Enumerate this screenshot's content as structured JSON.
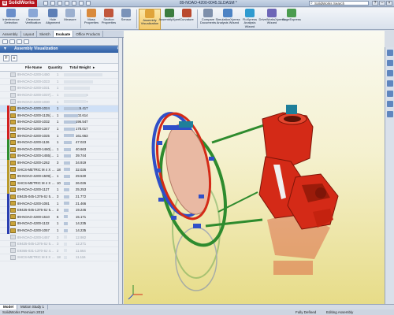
{
  "app": {
    "name": "SolidWorks",
    "document_title": "89-NOAO-4200-0045.SLDASM *",
    "search_placeholder": "SolidWorks Search"
  },
  "ribbon": [
    {
      "label": "Interference Detection",
      "color": "#6a8ec9"
    },
    {
      "label": "Clearance Verification",
      "color": "#8aa7d6"
    },
    {
      "label": "Hole Alignment",
      "color": "#5d7fb6"
    },
    {
      "label": "Measure",
      "color": "#9cb0cf"
    },
    {
      "label": "Mass Properties",
      "color": "#d98a3c"
    },
    {
      "label": "Section Properties",
      "color": "#c0563b"
    },
    {
      "label": "Sensor",
      "color": "#7b93b8"
    },
    {
      "label": "Assembly Visualization",
      "color": "#e0a43a",
      "active": true
    },
    {
      "label": "AssemblyXpert",
      "color": "#3c7c3f"
    },
    {
      "label": "Curvature",
      "color": "#b9492e"
    },
    {
      "label": "Compare Documents",
      "color": "#7d8faa"
    },
    {
      "label": "SimulationXpress Analysis Wizard",
      "color": "#4c83c4"
    },
    {
      "label": "FloXpress Analysis Wizard",
      "color": "#2f9bd0"
    },
    {
      "label": "DriveWorksXpress Wizard",
      "color": "#6d66b7"
    },
    {
      "label": "SageExpress",
      "color": "#4a9c4f"
    }
  ],
  "command_tabs": [
    {
      "label": "Assembly"
    },
    {
      "label": "Layout"
    },
    {
      "label": "Sketch"
    },
    {
      "label": "Evaluate",
      "active": true
    },
    {
      "label": "Office Products"
    }
  ],
  "panel": {
    "title": "Assembly Visualization",
    "columns": {
      "name": "File Name",
      "qty": "Quantity",
      "weight": "Total Weight"
    },
    "rows": [
      {
        "name": "89-NOAO-4200-1450",
        "qty": "1",
        "weight": "2142.565",
        "faded": true,
        "bar": 0.82
      },
      {
        "name": "89-NOAO-4200-1023",
        "qty": "1",
        "weight": "1146.889",
        "faded": true,
        "bar": 0.62
      },
      {
        "name": "89-NOAO-4200-1031",
        "qty": "1",
        "weight": "943.686",
        "faded": true,
        "bar": 0.55
      },
      {
        "name": "89-NOAO-4200-1037(Defa...",
        "qty": "1",
        "weight": "783.745",
        "faded": true,
        "bar": 0.48
      },
      {
        "name": "89-NOAO-4200-1030",
        "qty": "1",
        "weight": "756.867",
        "faded": true,
        "bar": 0.46
      },
      {
        "name": "89-NOAO-4200-1024",
        "qty": "1",
        "weight": "405.417",
        "hl": true,
        "bar": 0.34
      },
      {
        "name": "89-NOAO-4200-1125(Defa...",
        "qty": "1",
        "weight": "302.614",
        "bar": 0.3
      },
      {
        "name": "89-NOAO-4200-1032",
        "qty": "1",
        "weight": "196.547",
        "bar": 0.26
      },
      {
        "name": "89-NOAO-4200-1347",
        "qty": "1",
        "weight": "178.017",
        "bar": 0.24
      },
      {
        "name": "89-NOAO-4200-1025",
        "qty": "1",
        "weight": "161.663",
        "bar": 0.22
      },
      {
        "name": "89-NOAO-4200-1126",
        "qty": "1",
        "weight": "47.023",
        "bar": 0.16
      },
      {
        "name": "89-NOAO-4200-1460(Defa...",
        "qty": "1",
        "weight": "40.663",
        "bar": 0.15
      },
      {
        "name": "89-NOAO-4200-1455(Defa...",
        "qty": "1",
        "weight": "39.744",
        "bar": 0.15
      },
      {
        "name": "89-NOAO-4200-1262",
        "qty": "3",
        "weight": "34.919",
        "bar": 0.14
      },
      {
        "name": "SHCS-METRIC M 4 X 16...",
        "qty": "18",
        "weight": "32.026",
        "bar": 0.14
      },
      {
        "name": "89-NOAO-4200-1509(Defa...",
        "qty": "1",
        "weight": "29.530",
        "bar": 0.13
      },
      {
        "name": "SHCS-METRIC M 4 X 16...",
        "qty": "10",
        "weight": "26.026",
        "bar": 0.13
      },
      {
        "name": "89-NOAO-4200-1127",
        "qty": "1",
        "weight": "25.253",
        "bar": 0.12
      },
      {
        "name": "E9425-045-1376-SJ 50 LB...",
        "qty": "3",
        "weight": "21.772",
        "bar": 0.11
      },
      {
        "name": "89-NOAO-4200-1081",
        "qty": "1",
        "weight": "21.466",
        "bar": 0.11
      },
      {
        "name": "E9425-045-1376-SJ 50 LB...",
        "qty": "3",
        "weight": "19.246",
        "bar": 0.1
      },
      {
        "name": "89-NOAO-4200-1610",
        "qty": "6",
        "weight": "15.171",
        "bar": 0.09
      },
      {
        "name": "89-NOAO-4200-1122",
        "qty": "1",
        "weight": "14.235",
        "bar": 0.08
      },
      {
        "name": "89-NOAO-4200-1057",
        "qty": "1",
        "weight": "14.235",
        "bar": 0.08
      },
      {
        "name": "89-NOAO-4200-1457",
        "qty": "3",
        "weight": "12.982",
        "faded": true,
        "bar": 0.07
      },
      {
        "name": "E9425-045-1376-SJ 50 LB...",
        "qty": "3",
        "weight": "12.271",
        "faded": true,
        "bar": 0.07
      },
      {
        "name": "E9365-031-1370-SJ 44 LB...",
        "qty": "2",
        "weight": "11.664",
        "faded": true,
        "bar": 0.06
      },
      {
        "name": "SHCS-METRIC M 8 X 1.2...",
        "qty": "18",
        "weight": "11.116",
        "faded": true,
        "bar": 0.06
      }
    ],
    "groups": [
      {
        "color": "#d22020",
        "from": 5,
        "to": 9
      },
      {
        "color": "#2f8f2f",
        "from": 10,
        "to": 12
      },
      {
        "color": "#b99a2a",
        "from": 13,
        "to": 17
      },
      {
        "color": "#2b3fb0",
        "from": 18,
        "to": 23
      }
    ]
  },
  "bottom_tabs": [
    {
      "label": "Model",
      "active": true
    },
    {
      "label": "Motion Study 1"
    }
  ],
  "status": {
    "product": "SolidWorks Premium 2010",
    "state": "Fully Defined",
    "mode": "Editing Assembly"
  },
  "colors": {
    "casting_red": "#d42a17",
    "ring_green": "#2e8b2e",
    "hardware_blue": "#2f4fc8",
    "lens_peach": "#e9b9a3",
    "viewport_yellow": "#efe4a0"
  }
}
